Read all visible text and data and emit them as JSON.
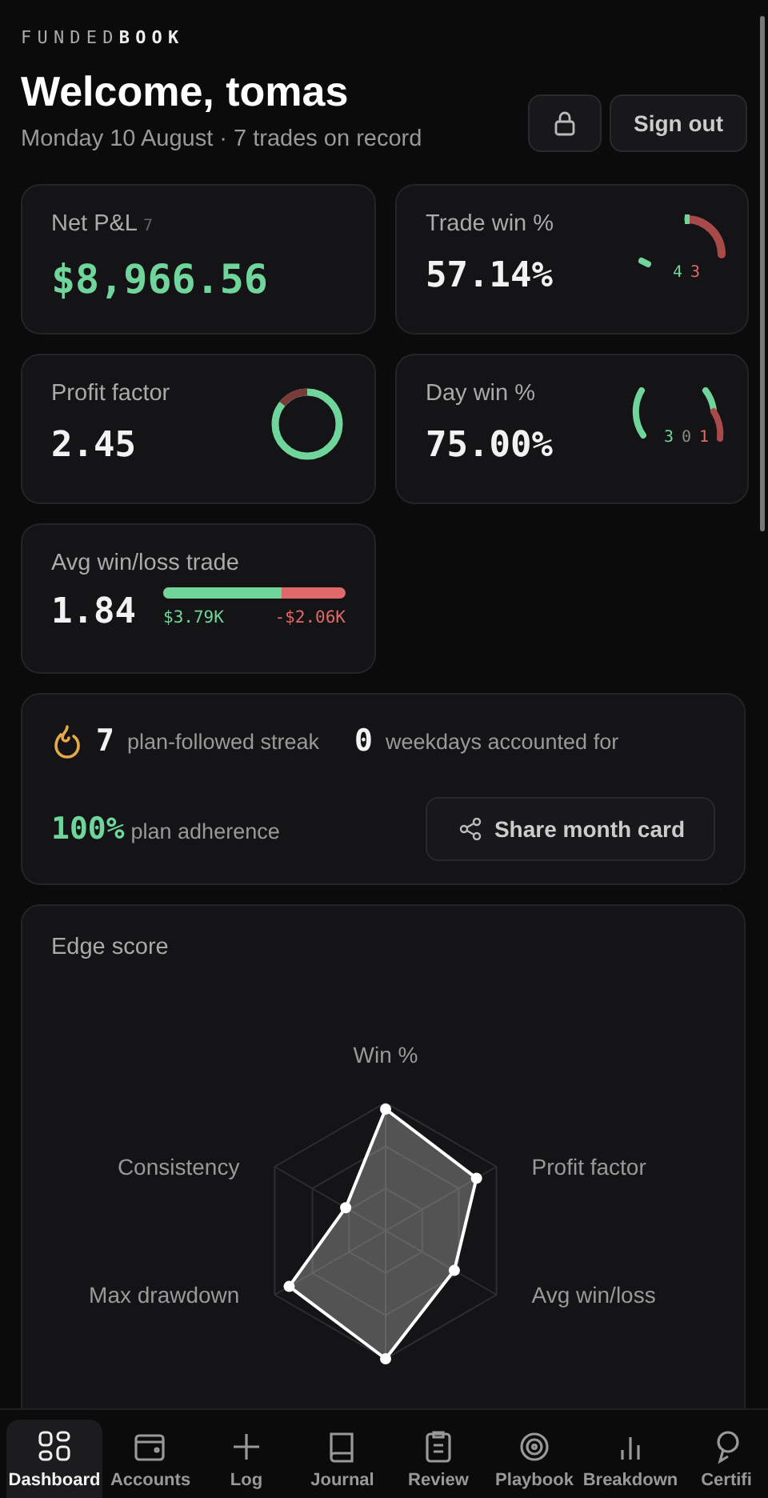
{
  "brand": {
    "dim": "FUNDED",
    "bright": "BOOK"
  },
  "header": {
    "title": "Welcome, tomas",
    "subtitle": "Monday 10 August · 7 trades on record",
    "sign_out": "Sign out"
  },
  "stats": [
    {
      "kind": "pnl",
      "label": "Net P&L",
      "badge": "7",
      "value": "$8,966.56"
    },
    {
      "kind": "trade_win",
      "label": "Trade win %",
      "value": "57.14%",
      "wins": "4",
      "losses": "3"
    },
    {
      "kind": "profit_factor",
      "label": "Profit factor",
      "value": "2.45"
    },
    {
      "kind": "day_win",
      "label": "Day win %",
      "value": "75.00%",
      "wins": "3",
      "breakeven": "0",
      "losses": "1"
    },
    {
      "kind": "avg",
      "label": "Avg win/loss trade",
      "value": "1.84",
      "avg_win": "$3.79K",
      "avg_loss": "-$2.06K",
      "level": 0.65
    }
  ],
  "streak": {
    "streak_value": "7",
    "streak_label": "plan-followed streak",
    "days_value": "0",
    "days_label": "weekdays accounted for",
    "adherence_value": "100%",
    "adherence_label": "plan adherence",
    "share": "Share month card"
  },
  "edge": {
    "title": "Edge score",
    "axes": [
      "Win %",
      "Profit factor",
      "Avg win/loss",
      "Max drawdown",
      "Consistency"
    ]
  },
  "nav": [
    {
      "label": "Dashboard",
      "selected": true
    },
    {
      "label": "Accounts",
      "selected": false
    },
    {
      "label": "Log",
      "selected": false
    },
    {
      "label": "Journal",
      "selected": false
    },
    {
      "label": "Review",
      "selected": false
    },
    {
      "label": "Playbook",
      "selected": false
    },
    {
      "label": "Breakdown",
      "selected": false
    },
    {
      "label": "Certifi",
      "selected": false
    }
  ]
}
